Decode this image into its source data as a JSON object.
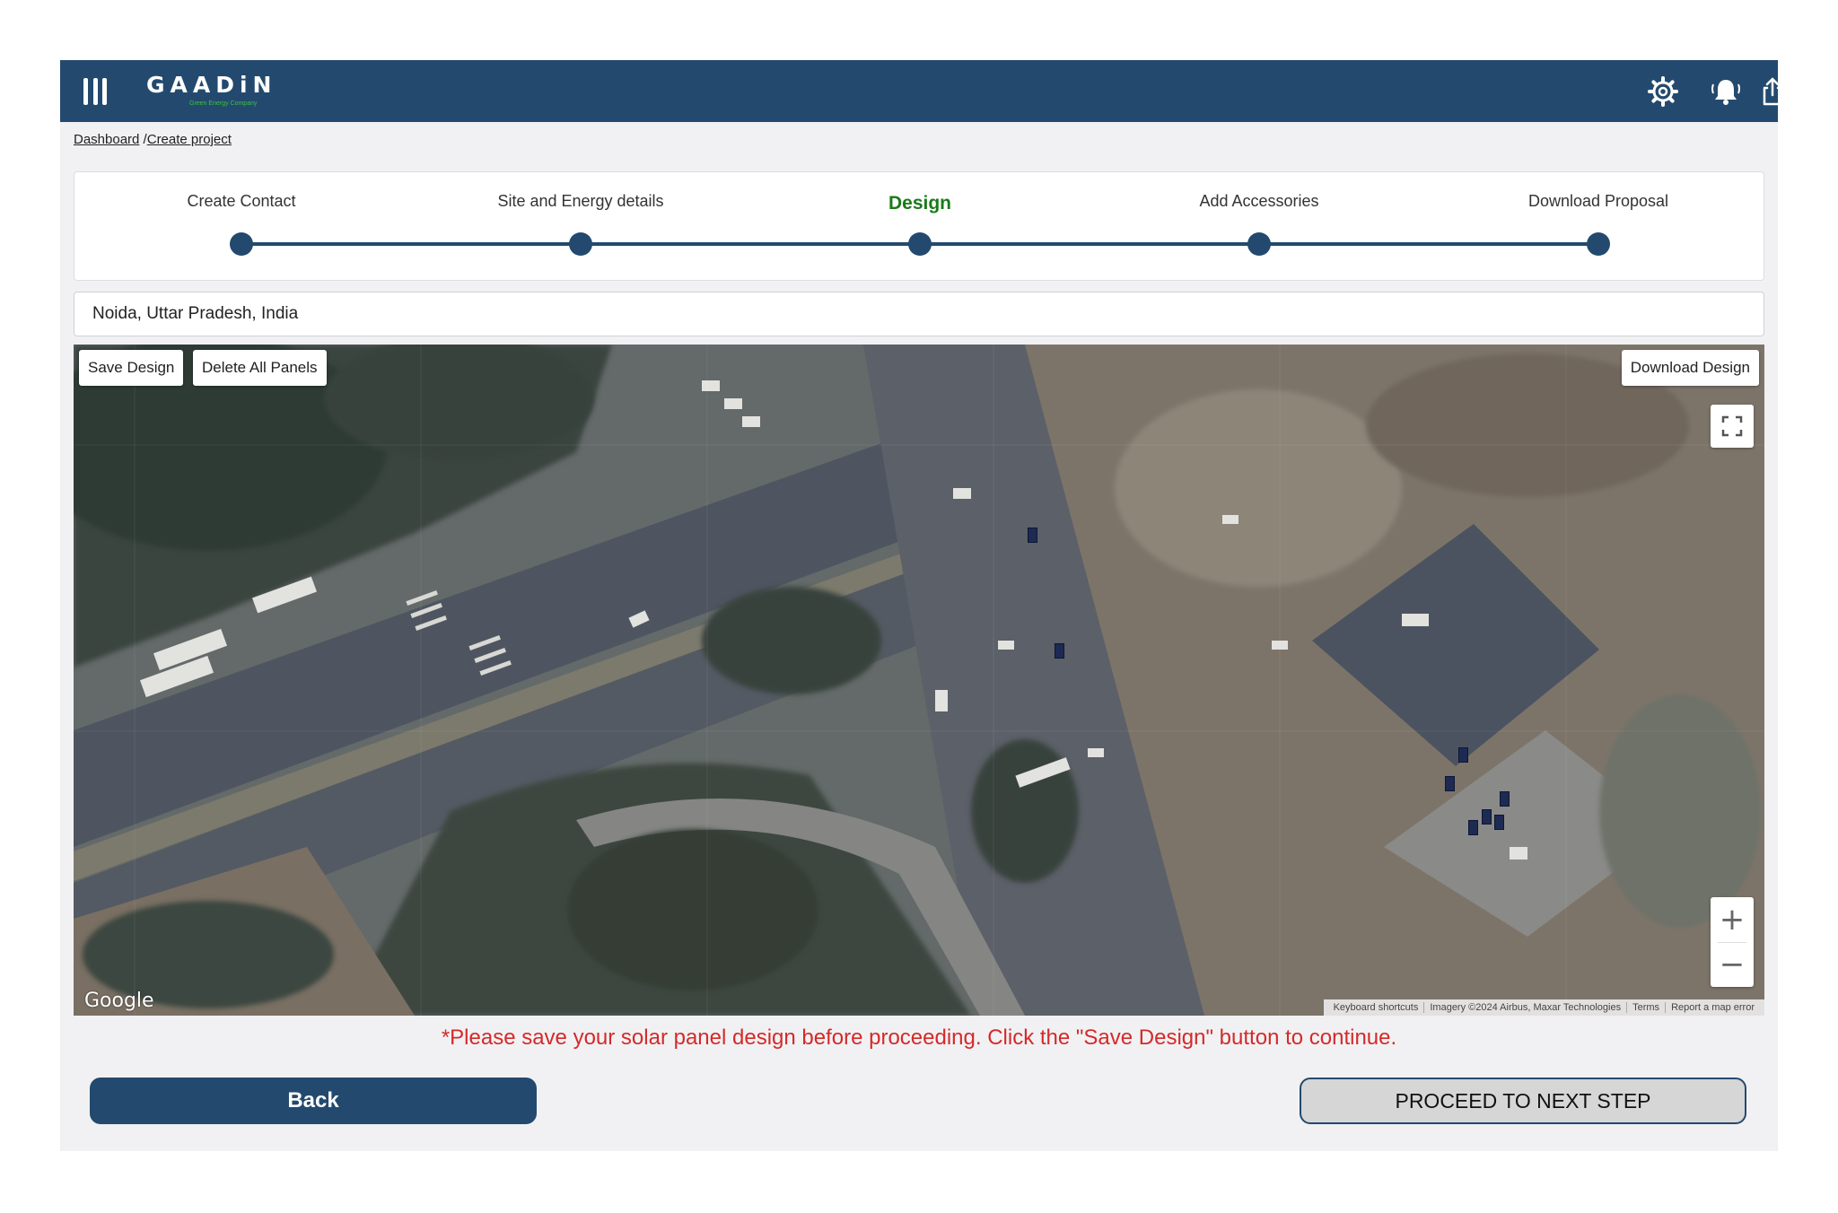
{
  "header": {
    "logo_text": "GAADiN",
    "logo_tagline": "Green Energy Company",
    "icons": [
      "menu-icon",
      "gear-icon",
      "bell-icon",
      "share-icon"
    ]
  },
  "breadcrumb": {
    "home": "Dashboard",
    "separator": " /",
    "current": "Create project"
  },
  "stepper": {
    "steps": [
      {
        "label": "Create Contact",
        "active": false
      },
      {
        "label": "Site and Energy details",
        "active": false
      },
      {
        "label": "Design",
        "active": true
      },
      {
        "label": "Add Accessories",
        "active": false
      },
      {
        "label": "Download Proposal",
        "active": false
      }
    ]
  },
  "address": {
    "value": "Noida, Uttar Pradesh, India"
  },
  "map": {
    "save_label": "Save Design",
    "delete_label": "Delete All Panels",
    "download_label": "Download Design",
    "zoom_in": "+",
    "zoom_out": "−",
    "google_logo": "Google",
    "attribution": {
      "keyboard": "Keyboard shortcuts",
      "imagery": "Imagery ©2024 Airbus, Maxar Technologies",
      "terms": "Terms",
      "report": "Report a map error"
    }
  },
  "warning": "*Please save your solar panel design before proceeding. Click the \"Save Design\" button to continue.",
  "actions": {
    "back_label": "Back",
    "next_label": "PROCEED TO NEXT STEP"
  },
  "colors": {
    "primary": "#234a6e",
    "active_step": "#1a7a1a",
    "warning": "#d42a2a",
    "panel": "#1d2a52"
  }
}
